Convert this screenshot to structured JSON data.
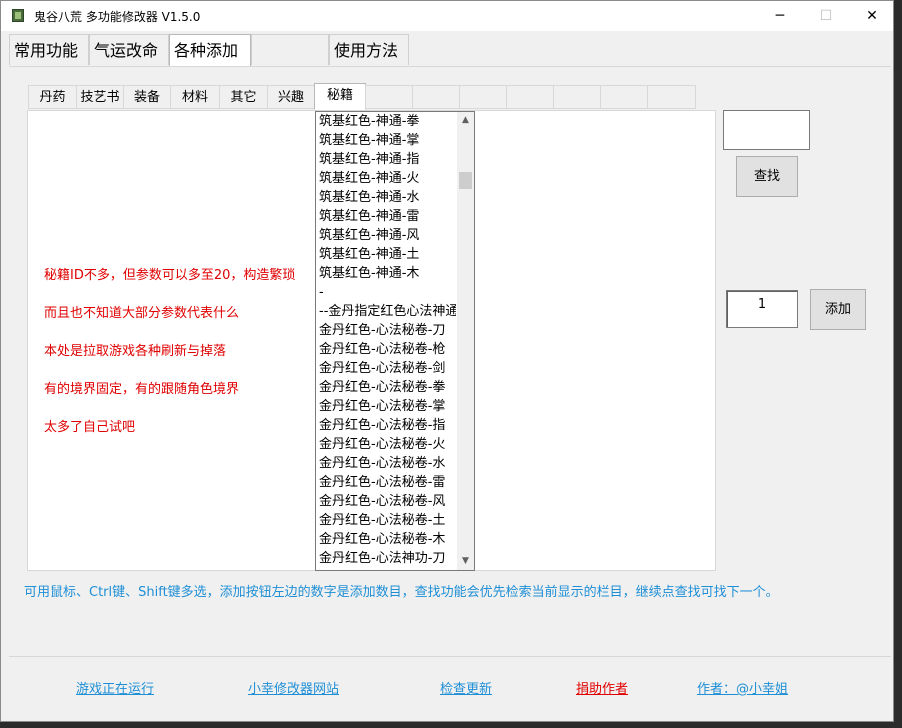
{
  "window": {
    "title": "鬼谷八荒 多功能修改器  V1.5.0",
    "minimize_glyph": "─",
    "maximize_glyph": "☐",
    "close_glyph": "✕"
  },
  "top_tabs": [
    {
      "label": "常用功能"
    },
    {
      "label": "气运改命"
    },
    {
      "label": "各种添加"
    },
    {
      "label": ""
    },
    {
      "label": "使用方法"
    }
  ],
  "sub_tabs": [
    {
      "label": "丹药"
    },
    {
      "label": "技艺书"
    },
    {
      "label": "装备"
    },
    {
      "label": "材料"
    },
    {
      "label": "其它"
    },
    {
      "label": "兴趣"
    },
    {
      "label": "秘籍"
    }
  ],
  "notes": [
    "秘籍ID不多，但参数可以多至20，构造繁琐",
    "而且也不知道大部分参数代表什么",
    "本处是拉取游戏各种刷新与掉落",
    "有的境界固定，有的跟随角色境界",
    "太多了自己试吧"
  ],
  "list_items": [
    "筑基红色-神通-拳",
    "筑基红色-神通-掌",
    "筑基红色-神通-指",
    "筑基红色-神通-火",
    "筑基红色-神通-水",
    "筑基红色-神通-雷",
    "筑基红色-神通-风",
    "筑基红色-神通-土",
    "筑基红色-神通-木",
    "-",
    "--金丹指定红色心法神通",
    "金丹红色-心法秘卷-刀",
    "金丹红色-心法秘卷-枪",
    "金丹红色-心法秘卷-剑",
    "金丹红色-心法秘卷-拳",
    "金丹红色-心法秘卷-掌",
    "金丹红色-心法秘卷-指",
    "金丹红色-心法秘卷-火",
    "金丹红色-心法秘卷-水",
    "金丹红色-心法秘卷-雷",
    "金丹红色-心法秘卷-风",
    "金丹红色-心法秘卷-土",
    "金丹红色-心法秘卷-木",
    "金丹红色-心法神功-刀"
  ],
  "scroll": {
    "up_glyph": "▲",
    "down_glyph": "▼"
  },
  "search": {
    "value": "",
    "button_label": "查找"
  },
  "add": {
    "quantity": "1",
    "button_label": "添加"
  },
  "hint": "可用鼠标、Ctrl键、Shift键多选，添加按钮左边的数字是添加数目，查找功能会优先检索当前显示的栏目，继续点查找可找下一个。",
  "footer": {
    "status": "游戏正在运行",
    "site": "小幸修改器网站",
    "update": "检查更新",
    "donate": "捐助作者",
    "author": "作者：@小幸姐"
  },
  "colors": {
    "note_red": "#e00000",
    "hint_blue": "#1e8fd6",
    "donate_red": "#e00000",
    "link_blue": "#1e8fd6"
  }
}
